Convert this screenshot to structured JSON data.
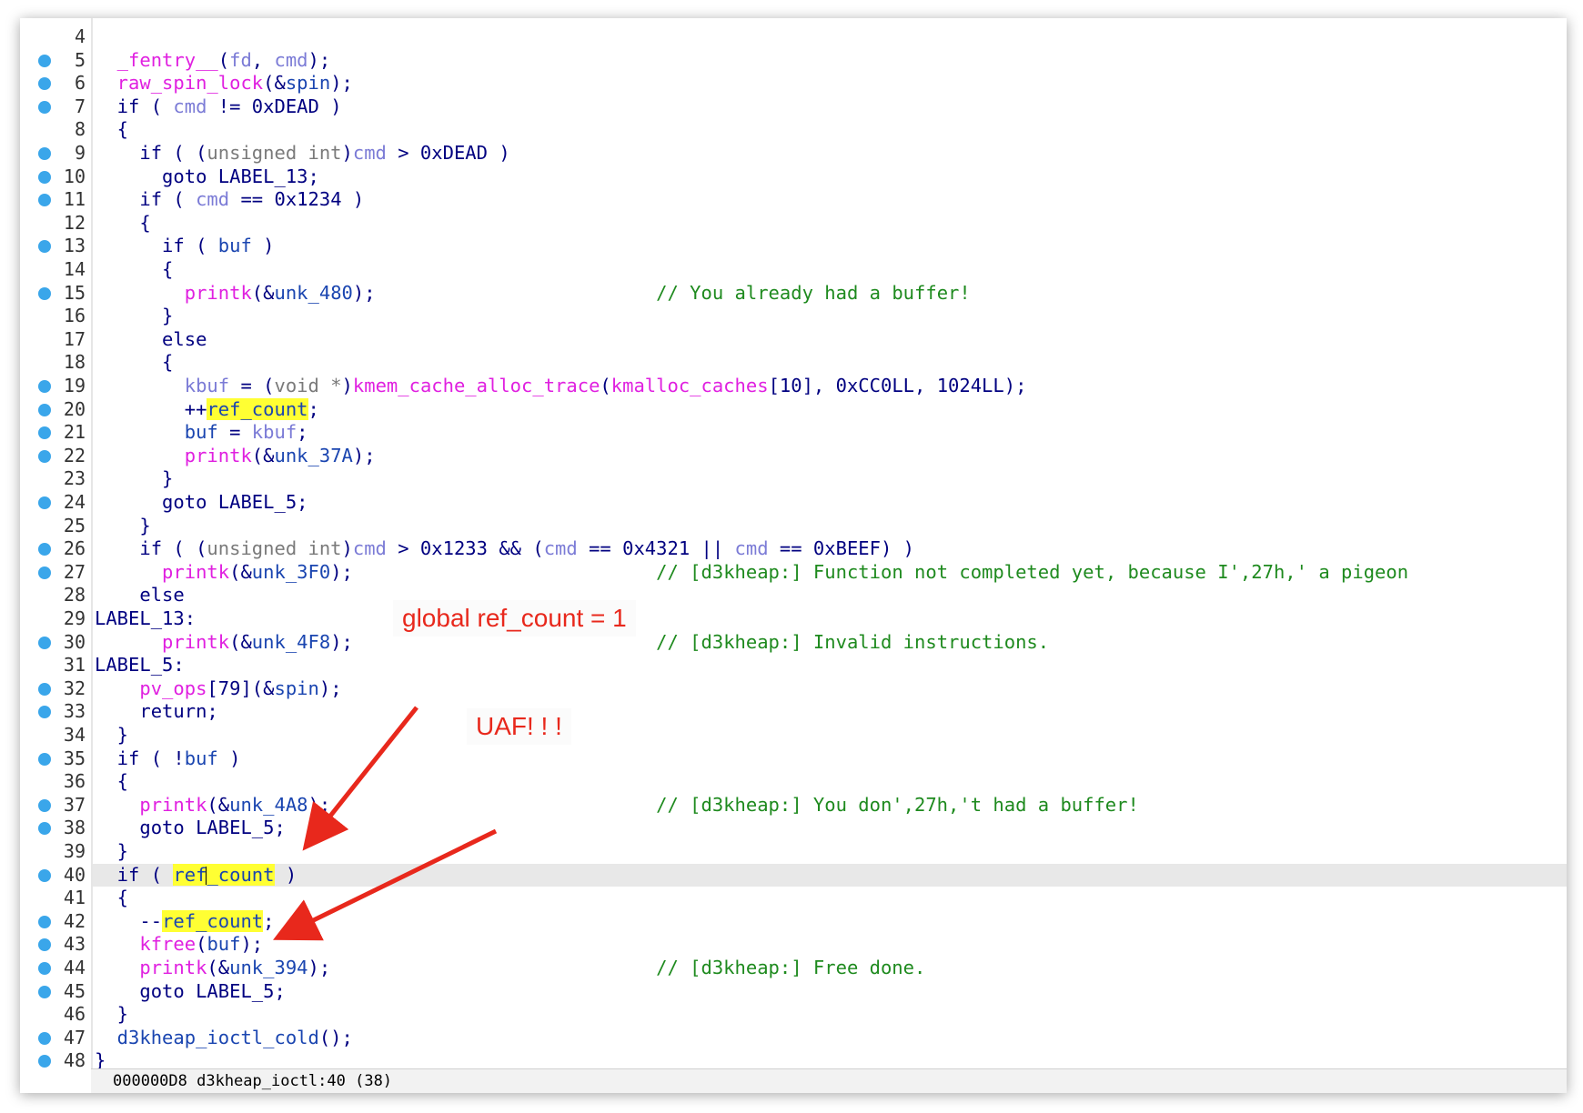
{
  "colors": {
    "keyword": "#000080",
    "function": "#e020e0",
    "variable": "#7b7bd6",
    "global": "#1a45b0",
    "comment": "#1e8a1e",
    "highlight": "#ffff33",
    "breakpoint_dot": "#3aa6ea",
    "annotation": "#e8281c"
  },
  "icons": {
    "breakpoint": "breakpoint-dot-icon"
  },
  "code": {
    "current_line": 40,
    "lines": [
      {
        "n": "4",
        "dot": false,
        "segs": []
      },
      {
        "n": "5",
        "dot": true,
        "segs": [
          [
            "fn",
            "  _fentry__"
          ],
          [
            "kw",
            "("
          ],
          [
            "var",
            "fd"
          ],
          [
            "kw",
            ", "
          ],
          [
            "var",
            "cmd"
          ],
          [
            "kw",
            ");"
          ]
        ]
      },
      {
        "n": "6",
        "dot": true,
        "segs": [
          [
            "fn",
            "  raw_spin_lock"
          ],
          [
            "kw",
            "(&"
          ],
          [
            "glb",
            "spin"
          ],
          [
            "kw",
            ");"
          ]
        ]
      },
      {
        "n": "7",
        "dot": true,
        "segs": [
          [
            "kw",
            "  if ( "
          ],
          [
            "var",
            "cmd"
          ],
          [
            "kw",
            " != 0xDEAD )"
          ]
        ]
      },
      {
        "n": "8",
        "dot": false,
        "segs": [
          [
            "kw",
            "  {"
          ]
        ]
      },
      {
        "n": "9",
        "dot": true,
        "segs": [
          [
            "kw",
            "    if ( ("
          ],
          [
            "gray",
            "unsigned int"
          ],
          [
            "kw",
            ")"
          ],
          [
            "var",
            "cmd"
          ],
          [
            "kw",
            " > 0xDEAD )"
          ]
        ]
      },
      {
        "n": "10",
        "dot": true,
        "segs": [
          [
            "kw",
            "      goto LABEL_13;"
          ]
        ]
      },
      {
        "n": "11",
        "dot": true,
        "segs": [
          [
            "kw",
            "    if ( "
          ],
          [
            "var",
            "cmd"
          ],
          [
            "kw",
            " == 0x1234 )"
          ]
        ]
      },
      {
        "n": "12",
        "dot": false,
        "segs": [
          [
            "kw",
            "    {"
          ]
        ]
      },
      {
        "n": "13",
        "dot": true,
        "segs": [
          [
            "kw",
            "      if ( "
          ],
          [
            "glb",
            "buf"
          ],
          [
            "kw",
            " )"
          ]
        ]
      },
      {
        "n": "14",
        "dot": false,
        "segs": [
          [
            "kw",
            "      {"
          ]
        ]
      },
      {
        "n": "15",
        "dot": true,
        "segs": [
          [
            "fn",
            "        printk"
          ],
          [
            "kw",
            "(&"
          ],
          [
            "glb",
            "unk_480"
          ],
          [
            "kw",
            ");"
          ],
          [
            "kw",
            "                         "
          ],
          [
            "cm",
            "// You already had a buffer!"
          ]
        ]
      },
      {
        "n": "16",
        "dot": false,
        "segs": [
          [
            "kw",
            "      }"
          ]
        ]
      },
      {
        "n": "17",
        "dot": false,
        "segs": [
          [
            "kw",
            "      else"
          ]
        ]
      },
      {
        "n": "18",
        "dot": false,
        "segs": [
          [
            "kw",
            "      {"
          ]
        ]
      },
      {
        "n": "19",
        "dot": true,
        "segs": [
          [
            "var",
            "        kbuf"
          ],
          [
            "kw",
            " = ("
          ],
          [
            "gray",
            "void *"
          ],
          [
            "kw",
            ")"
          ],
          [
            "fn",
            "kmem_cache_alloc_trace"
          ],
          [
            "kw",
            "("
          ],
          [
            "fn",
            "kmalloc_caches"
          ],
          [
            "kw",
            "[10], 0xCC0LL, 1024LL);"
          ]
        ]
      },
      {
        "n": "20",
        "dot": true,
        "segs": [
          [
            "kw",
            "        ++"
          ],
          [
            "hl",
            "ref_count"
          ],
          [
            "kw",
            ";"
          ]
        ]
      },
      {
        "n": "21",
        "dot": true,
        "segs": [
          [
            "glb",
            "        buf"
          ],
          [
            "kw",
            " = "
          ],
          [
            "var",
            "kbuf"
          ],
          [
            "kw",
            ";"
          ]
        ]
      },
      {
        "n": "22",
        "dot": true,
        "segs": [
          [
            "fn",
            "        printk"
          ],
          [
            "kw",
            "(&"
          ],
          [
            "glb",
            "unk_37A"
          ],
          [
            "kw",
            ");"
          ]
        ]
      },
      {
        "n": "23",
        "dot": false,
        "segs": [
          [
            "kw",
            "      }"
          ]
        ]
      },
      {
        "n": "24",
        "dot": true,
        "segs": [
          [
            "kw",
            "      goto LABEL_5;"
          ]
        ]
      },
      {
        "n": "25",
        "dot": false,
        "segs": [
          [
            "kw",
            "    }"
          ]
        ]
      },
      {
        "n": "26",
        "dot": true,
        "segs": [
          [
            "kw",
            "    if ( ("
          ],
          [
            "gray",
            "unsigned int"
          ],
          [
            "kw",
            ")"
          ],
          [
            "var",
            "cmd"
          ],
          [
            "kw",
            " > 0x1233 && ("
          ],
          [
            "var",
            "cmd"
          ],
          [
            "kw",
            " == 0x4321 || "
          ],
          [
            "var",
            "cmd"
          ],
          [
            "kw",
            " == 0xBEEF) )"
          ]
        ]
      },
      {
        "n": "27",
        "dot": true,
        "segs": [
          [
            "fn",
            "      printk"
          ],
          [
            "kw",
            "(&"
          ],
          [
            "glb",
            "unk_3F0"
          ],
          [
            "kw",
            ");"
          ],
          [
            "kw",
            "                           "
          ],
          [
            "cm",
            "// [d3kheap:] Function not completed yet, because I',27h,' a pigeon"
          ]
        ]
      },
      {
        "n": "28",
        "dot": false,
        "segs": [
          [
            "kw",
            "    else"
          ]
        ]
      },
      {
        "n": "29",
        "dot": false,
        "segs": [
          [
            "lbl",
            "LABEL_13:"
          ]
        ]
      },
      {
        "n": "30",
        "dot": true,
        "segs": [
          [
            "fn",
            "      printk"
          ],
          [
            "kw",
            "(&"
          ],
          [
            "glb",
            "unk_4F8"
          ],
          [
            "kw",
            ");"
          ],
          [
            "kw",
            "                           "
          ],
          [
            "cm",
            "// [d3kheap:] Invalid instructions."
          ]
        ]
      },
      {
        "n": "31",
        "dot": false,
        "segs": [
          [
            "lbl",
            "LABEL_5:"
          ]
        ]
      },
      {
        "n": "32",
        "dot": true,
        "segs": [
          [
            "fn",
            "    pv_ops"
          ],
          [
            "kw",
            "[79](&"
          ],
          [
            "glb",
            "spin"
          ],
          [
            "kw",
            ");"
          ]
        ]
      },
      {
        "n": "33",
        "dot": true,
        "segs": [
          [
            "kw",
            "    return;"
          ]
        ]
      },
      {
        "n": "34",
        "dot": false,
        "segs": [
          [
            "kw",
            "  }"
          ]
        ]
      },
      {
        "n": "35",
        "dot": true,
        "segs": [
          [
            "kw",
            "  if ( !"
          ],
          [
            "glb",
            "buf"
          ],
          [
            "kw",
            " )"
          ]
        ]
      },
      {
        "n": "36",
        "dot": false,
        "segs": [
          [
            "kw",
            "  {"
          ]
        ]
      },
      {
        "n": "37",
        "dot": true,
        "segs": [
          [
            "fn",
            "    printk"
          ],
          [
            "kw",
            "(&"
          ],
          [
            "glb",
            "unk_4A8"
          ],
          [
            "kw",
            ");"
          ],
          [
            "kw",
            "                             "
          ],
          [
            "cm",
            "// [d3kheap:] You don',27h,'t had a buffer!"
          ]
        ]
      },
      {
        "n": "38",
        "dot": true,
        "segs": [
          [
            "kw",
            "    goto LABEL_5;"
          ]
        ]
      },
      {
        "n": "39",
        "dot": false,
        "segs": [
          [
            "kw",
            "  }"
          ]
        ]
      },
      {
        "n": "40",
        "dot": true,
        "segs": [
          [
            "kw",
            "  if ( "
          ],
          [
            "hl",
            "ref"
          ],
          [
            "cursor",
            ""
          ],
          [
            "hl",
            "_count"
          ],
          [
            "kw",
            " )"
          ]
        ]
      },
      {
        "n": "41",
        "dot": false,
        "segs": [
          [
            "kw",
            "  {"
          ]
        ]
      },
      {
        "n": "42",
        "dot": true,
        "segs": [
          [
            "kw",
            "    --"
          ],
          [
            "hl",
            "ref_count"
          ],
          [
            "kw",
            ";"
          ]
        ]
      },
      {
        "n": "43",
        "dot": true,
        "segs": [
          [
            "fn",
            "    kfree"
          ],
          [
            "kw",
            "("
          ],
          [
            "glb",
            "buf"
          ],
          [
            "kw",
            ");"
          ]
        ]
      },
      {
        "n": "44",
        "dot": true,
        "segs": [
          [
            "fn",
            "    printk"
          ],
          [
            "kw",
            "(&"
          ],
          [
            "glb",
            "unk_394"
          ],
          [
            "kw",
            ");"
          ],
          [
            "kw",
            "                             "
          ],
          [
            "cm",
            "// [d3kheap:] Free done."
          ]
        ]
      },
      {
        "n": "45",
        "dot": true,
        "segs": [
          [
            "kw",
            "    goto LABEL_5;"
          ]
        ]
      },
      {
        "n": "46",
        "dot": false,
        "segs": [
          [
            "kw",
            "  }"
          ]
        ]
      },
      {
        "n": "47",
        "dot": true,
        "segs": [
          [
            "glb",
            "  d3kheap_ioctl_cold"
          ],
          [
            "kw",
            "();"
          ]
        ]
      },
      {
        "n": "48",
        "dot": true,
        "segs": [
          [
            "kw",
            "}"
          ]
        ]
      }
    ]
  },
  "status_bar": {
    "text": "000000D8 d3kheap_ioctl:40 (38)"
  },
  "annotations": {
    "global_ref_count": "global ref_count =   1",
    "uaf": "UAF! ! !"
  }
}
